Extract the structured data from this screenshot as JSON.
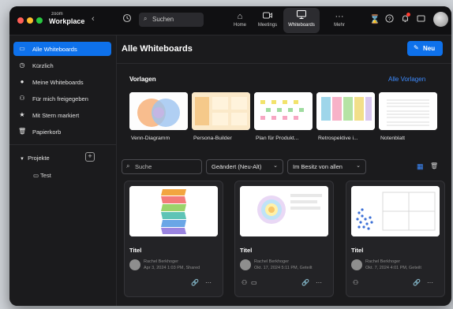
{
  "app": {
    "brand_small": "zoom",
    "brand": "Workplace"
  },
  "topbar": {
    "back_icon": "chevron-left-icon",
    "search_placeholder": "Suchen",
    "nav": [
      {
        "label": "Home",
        "icon": "home-icon"
      },
      {
        "label": "Meetings",
        "icon": "video-camera-icon"
      },
      {
        "label": "Whiteboards",
        "icon": "whiteboard-icon",
        "active": true
      },
      {
        "label": "Mehr",
        "icon": "more-dots-icon"
      }
    ]
  },
  "sidebar": {
    "items": [
      {
        "label": "Alle Whiteboards",
        "icon": "whiteboard-icon",
        "active": true
      },
      {
        "label": "Kürzlich",
        "icon": "clock-icon"
      },
      {
        "label": "Meine Whiteboards",
        "icon": "person-icon"
      },
      {
        "label": "Für mich freigegeben",
        "icon": "people-icon"
      },
      {
        "label": "Mit Stern markiert",
        "icon": "star-icon"
      },
      {
        "label": "Papierkorb",
        "icon": "trash-icon"
      }
    ],
    "projects_label": "Projekte",
    "project_items": [
      {
        "label": "Test",
        "icon": "folder-icon"
      }
    ]
  },
  "main": {
    "title": "Alle Whiteboards",
    "new_button": "Neu",
    "templates_label": "Vorlagen",
    "templates_all": "Alle Vorlagen",
    "templates": [
      {
        "label": "Venn-Diagramm"
      },
      {
        "label": "Persona-Builder"
      },
      {
        "label": "Plan für Produkt..."
      },
      {
        "label": "Retrospektive i..."
      },
      {
        "label": "Notenblatt"
      }
    ],
    "search_placeholder": "Suche",
    "sort_label": "Geändert (Neu-Alt)",
    "owner_filter": "Im Besitz von allen",
    "cards": [
      {
        "title": "Titel",
        "owner": "Rachel Berkhoger",
        "date": "Apr 3, 2024 1:03 PM, Shared"
      },
      {
        "title": "Titel",
        "owner": "Rachel Berkhoger",
        "date": "Okt. 17, 2024 5:11 PM, Geteilt"
      },
      {
        "title": "Titel",
        "owner": "Rachel Berkhoger",
        "date": "Okt. 7, 2024 4:01 PM, Geteilt"
      }
    ]
  },
  "colors": {
    "accent": "#0e71eb",
    "link": "#3d8bff",
    "background": "#1b1b1d"
  }
}
